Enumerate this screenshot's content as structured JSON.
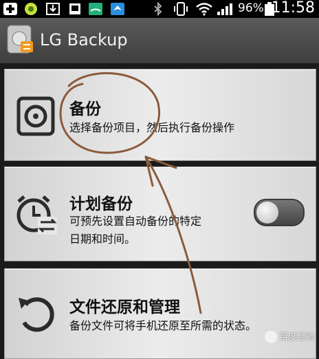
{
  "status_bar": {
    "battery": "96%",
    "time": "11:58"
  },
  "app_bar": {
    "title": "LG Backup"
  },
  "cards": [
    {
      "title": "备份",
      "description": "选择备份项目，然后执行备份操作"
    },
    {
      "title": "计划备份",
      "description_line1": "可预先设置自动备份的特定",
      "description_line2": "日期和时间。"
    },
    {
      "title": "文件还原和管理",
      "description": "备份文件可将手机还原至所需的状态。"
    }
  ],
  "watermark": "百度经验"
}
